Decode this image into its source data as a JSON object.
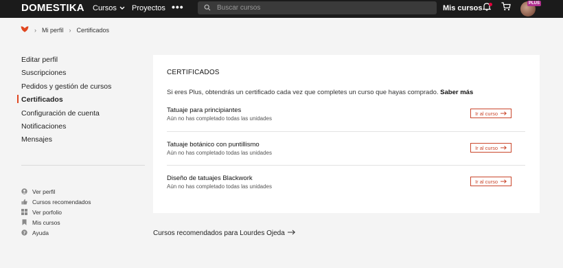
{
  "header": {
    "logo": "DOMESTIKA",
    "courses_label": "Cursos",
    "projects_label": "Proyectos",
    "more_label": "•••",
    "search_placeholder": "Buscar cursos",
    "my_courses_label": "Mis cursos",
    "plus_badge": "PLUS",
    "accent_color": "#e0003a"
  },
  "breadcrumb": {
    "items": [
      "Mi perfil",
      "Certificados"
    ]
  },
  "sidebar": {
    "items": [
      {
        "label": "Editar perfil",
        "active": false
      },
      {
        "label": "Suscripciones",
        "active": false
      },
      {
        "label": "Pedidos y gestión de cursos",
        "active": false
      },
      {
        "label": "Certificados",
        "active": true
      },
      {
        "label": "Configuración de cuenta",
        "active": false
      },
      {
        "label": "Notificaciones",
        "active": false
      },
      {
        "label": "Mensajes",
        "active": false
      }
    ],
    "links": [
      {
        "label": "Ver perfil",
        "icon": "user-icon"
      },
      {
        "label": "Cursos recomendados",
        "icon": "thumbs-up-icon"
      },
      {
        "label": "Ver porfolio",
        "icon": "grid-icon"
      },
      {
        "label": "Mis cursos",
        "icon": "bookmark-icon"
      },
      {
        "label": "Ayuda",
        "icon": "help-icon"
      }
    ]
  },
  "certificates": {
    "title": "CERTIFICADOS",
    "intro_text": "Si eres Plus, obtendrás un certificado cada vez que completes un curso que hayas comprado.",
    "learn_more": "Saber más",
    "button_label": "Ir al curso",
    "courses": [
      {
        "name": "Tatuaje para principiantes",
        "status": "Aún no has completado todas las unidades"
      },
      {
        "name": "Tatuaje botánico con puntillismo",
        "status": "Aún no has completado todas las unidades"
      },
      {
        "name": "Diseño de tatuajes Blackwork",
        "status": "Aún no has completado todas las unidades"
      }
    ]
  },
  "recommended_link": "Cursos recomendados para Lourdes Ojeda"
}
